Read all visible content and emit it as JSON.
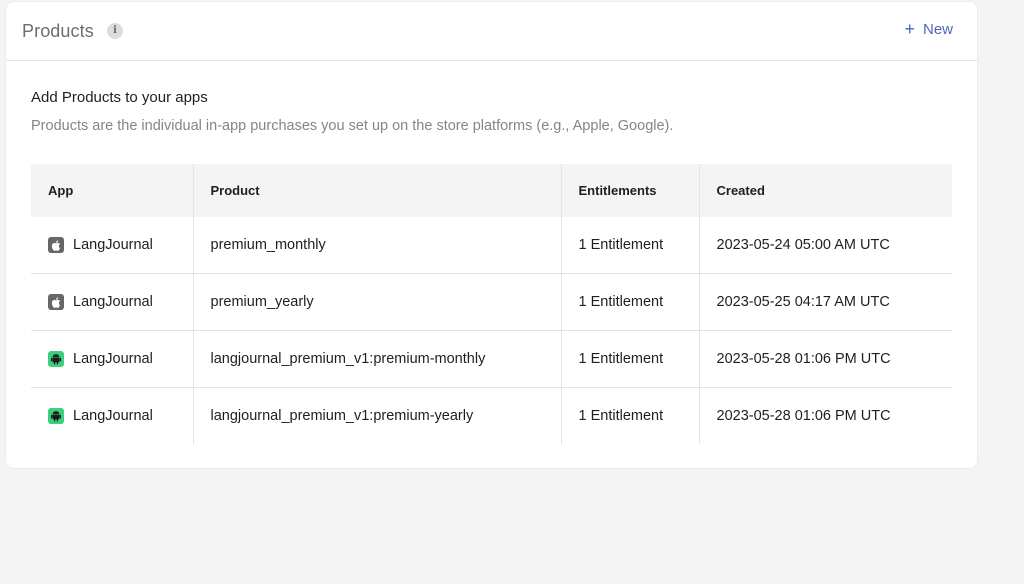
{
  "header": {
    "title": "Products",
    "info_icon": "info-icon",
    "new_label": "New",
    "new_icon": "plus-icon",
    "accent_color": "#5066b8"
  },
  "intro": {
    "heading": "Add Products to your apps",
    "description": "Products are the individual in-app purchases you set up on the store platforms (e.g., Apple, Google)."
  },
  "table": {
    "columns": [
      "App",
      "Product",
      "Entitlements",
      "Created"
    ],
    "rows": [
      {
        "platform_icon": "apple-icon",
        "app": "LangJournal",
        "product": "premium_monthly",
        "entitlements": "1 Entitlement",
        "created": "2023-05-24 05:00 AM UTC"
      },
      {
        "platform_icon": "apple-icon",
        "app": "LangJournal",
        "product": "premium_yearly",
        "entitlements": "1 Entitlement",
        "created": "2023-05-25 04:17 AM UTC"
      },
      {
        "platform_icon": "android-icon",
        "app": "LangJournal",
        "product": "langjournal_premium_v1:premium-monthly",
        "entitlements": "1 Entitlement",
        "created": "2023-05-28 01:06 PM UTC"
      },
      {
        "platform_icon": "android-icon",
        "app": "LangJournal",
        "product": "langjournal_premium_v1:premium-yearly",
        "entitlements": "1 Entitlement",
        "created": "2023-05-28 01:06 PM UTC"
      }
    ]
  }
}
